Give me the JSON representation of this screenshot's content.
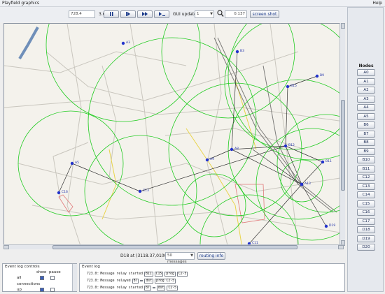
{
  "menu": {
    "title": "Playfield graphics",
    "help": "Help"
  },
  "toolbar": {
    "time_value": "728.4",
    "fps": "3.63 1/s",
    "gui_update_label": "GUI update:",
    "gui_update_value": "1",
    "zoom_value": "0.137",
    "screenshot_label": "screen shot"
  },
  "status": {
    "location": "D18 at (3118.37,0100.50)",
    "messages_option": "50 messages",
    "routing_label": "routing info"
  },
  "nodes_panel": {
    "title": "Nodes",
    "items": [
      "A0",
      "A1",
      "A2",
      "A3",
      "A4",
      "A5",
      "B6",
      "B7",
      "B8",
      "B9",
      "B10",
      "B11",
      "C12",
      "C13",
      "C14",
      "C15",
      "C16",
      "C17",
      "D18",
      "D19",
      "D20"
    ]
  },
  "event_controls": {
    "title": "Event log controls",
    "col_show": "show",
    "col_pause": "pause",
    "rows": [
      "all",
      "connections",
      "up"
    ]
  },
  "event_log": {
    "title": "Event log",
    "lines": [
      {
        "time": "723.0:",
        "text": "Message relay started",
        "a": "B11",
        "b": "C15",
        "c": "prog",
        "d": "C2-5"
      },
      {
        "time": "723.0:",
        "text": "Message relayed",
        "a": "B7",
        "b": "",
        "c": "dst",
        "d": "prog C2-5"
      },
      {
        "time": "723.0:",
        "text": "Message relay started",
        "a": "B7",
        "b": "",
        "c": "dst",
        "d": "C2-5"
      }
    ]
  },
  "map_labels": [
    "A3",
    "B3",
    "B9",
    "B15",
    "A8",
    "B12",
    "A9",
    "A5",
    "B11",
    "A13",
    "C13",
    "C16",
    "C11",
    "D19"
  ],
  "colors": {
    "range_circle": "#22cc22",
    "link": "#444444",
    "node": "#2233cc",
    "map_bg": "#f4f2ec",
    "accent_button": "#1a3a8a"
  }
}
